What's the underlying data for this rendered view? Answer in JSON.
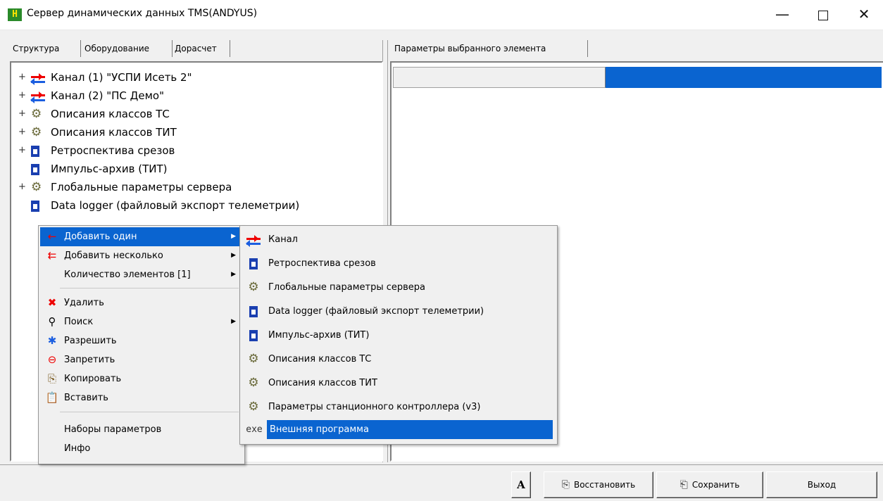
{
  "window": {
    "title": "Сервер динамических данных TMS(ANDYUS)",
    "app_icon": "H",
    "minimize": "—",
    "close": "✕"
  },
  "left_tabs": [
    "Структура",
    "Оборудование",
    "Дорасчет"
  ],
  "right_tabs": [
    "Параметры выбранного элемента"
  ],
  "tree": [
    {
      "label": "Канал  (1) \"УСПИ Исеть 2\"",
      "icon": "channel-icon",
      "expandable": true
    },
    {
      "label": "Канал  (2) \"ПС Демо\"",
      "icon": "channel-icon",
      "expandable": true
    },
    {
      "label": "Описания классов ТС",
      "icon": "gears-icon",
      "expandable": true
    },
    {
      "label": "Описания классов ТИТ",
      "icon": "gears-icon",
      "expandable": true
    },
    {
      "label": "Ретроспектива срезов",
      "icon": "document-icon",
      "expandable": true
    },
    {
      "label": "Импульс-архив (ТИТ)",
      "icon": "document-icon",
      "expandable": false
    },
    {
      "label": "Глобальные параметры сервера",
      "icon": "gears-icon",
      "expandable": true
    },
    {
      "label": "Data logger (файловый экспорт телеметрии)",
      "icon": "document-icon",
      "expandable": false
    }
  ],
  "context_menu": {
    "items": [
      {
        "label": "Добавить один",
        "icon": "arrow-left-icon",
        "submenu": true,
        "highlighted": true
      },
      {
        "label": "Добавить несколько",
        "icon": "arrows-icon",
        "submenu": true
      },
      {
        "label": "Количество элементов [1]",
        "icon": "",
        "submenu": true
      },
      {
        "label": "Удалить",
        "icon": "delete-icon",
        "submenu": false
      },
      {
        "label": "Поиск",
        "icon": "search-icon",
        "submenu": true
      },
      {
        "label": "Разрешить",
        "icon": "enable-icon",
        "submenu": false
      },
      {
        "label": "Запретить",
        "icon": "disable-icon",
        "submenu": false
      },
      {
        "label": "Копировать",
        "icon": "copy-icon",
        "submenu": false
      },
      {
        "label": "Вставить",
        "icon": "paste-icon",
        "submenu": false
      },
      {
        "label": "Наборы параметров",
        "icon": "",
        "submenu": false
      },
      {
        "label": "Инфо",
        "icon": "",
        "submenu": false
      }
    ]
  },
  "submenu": {
    "items": [
      {
        "label": "Канал",
        "icon": "channel-icon"
      },
      {
        "label": "Ретроспектива срезов",
        "icon": "document-icon"
      },
      {
        "label": "Глобальные параметры сервера",
        "icon": "gears-icon"
      },
      {
        "label": "Data logger (файловый экспорт телеметрии)",
        "icon": "document-icon"
      },
      {
        "label": "Импульс-архив (ТИТ)",
        "icon": "document-icon"
      },
      {
        "label": "Описания классов ТС",
        "icon": "gears-icon"
      },
      {
        "label": "Описания классов ТИТ",
        "icon": "gears-icon"
      },
      {
        "label": "Параметры станционного контроллера (v3)",
        "icon": "gears-icon"
      },
      {
        "label": "Внешняя программа",
        "icon": "exe-icon",
        "highlighted": true
      }
    ],
    "exe_text": "exe"
  },
  "buttons": {
    "font": "A",
    "restore": "Восстановить",
    "save": "Сохранить",
    "exit": "Выход"
  },
  "colors": {
    "highlight": "#0a64d0",
    "channel_red": "#e00000",
    "channel_blue": "#1b5ee0"
  }
}
